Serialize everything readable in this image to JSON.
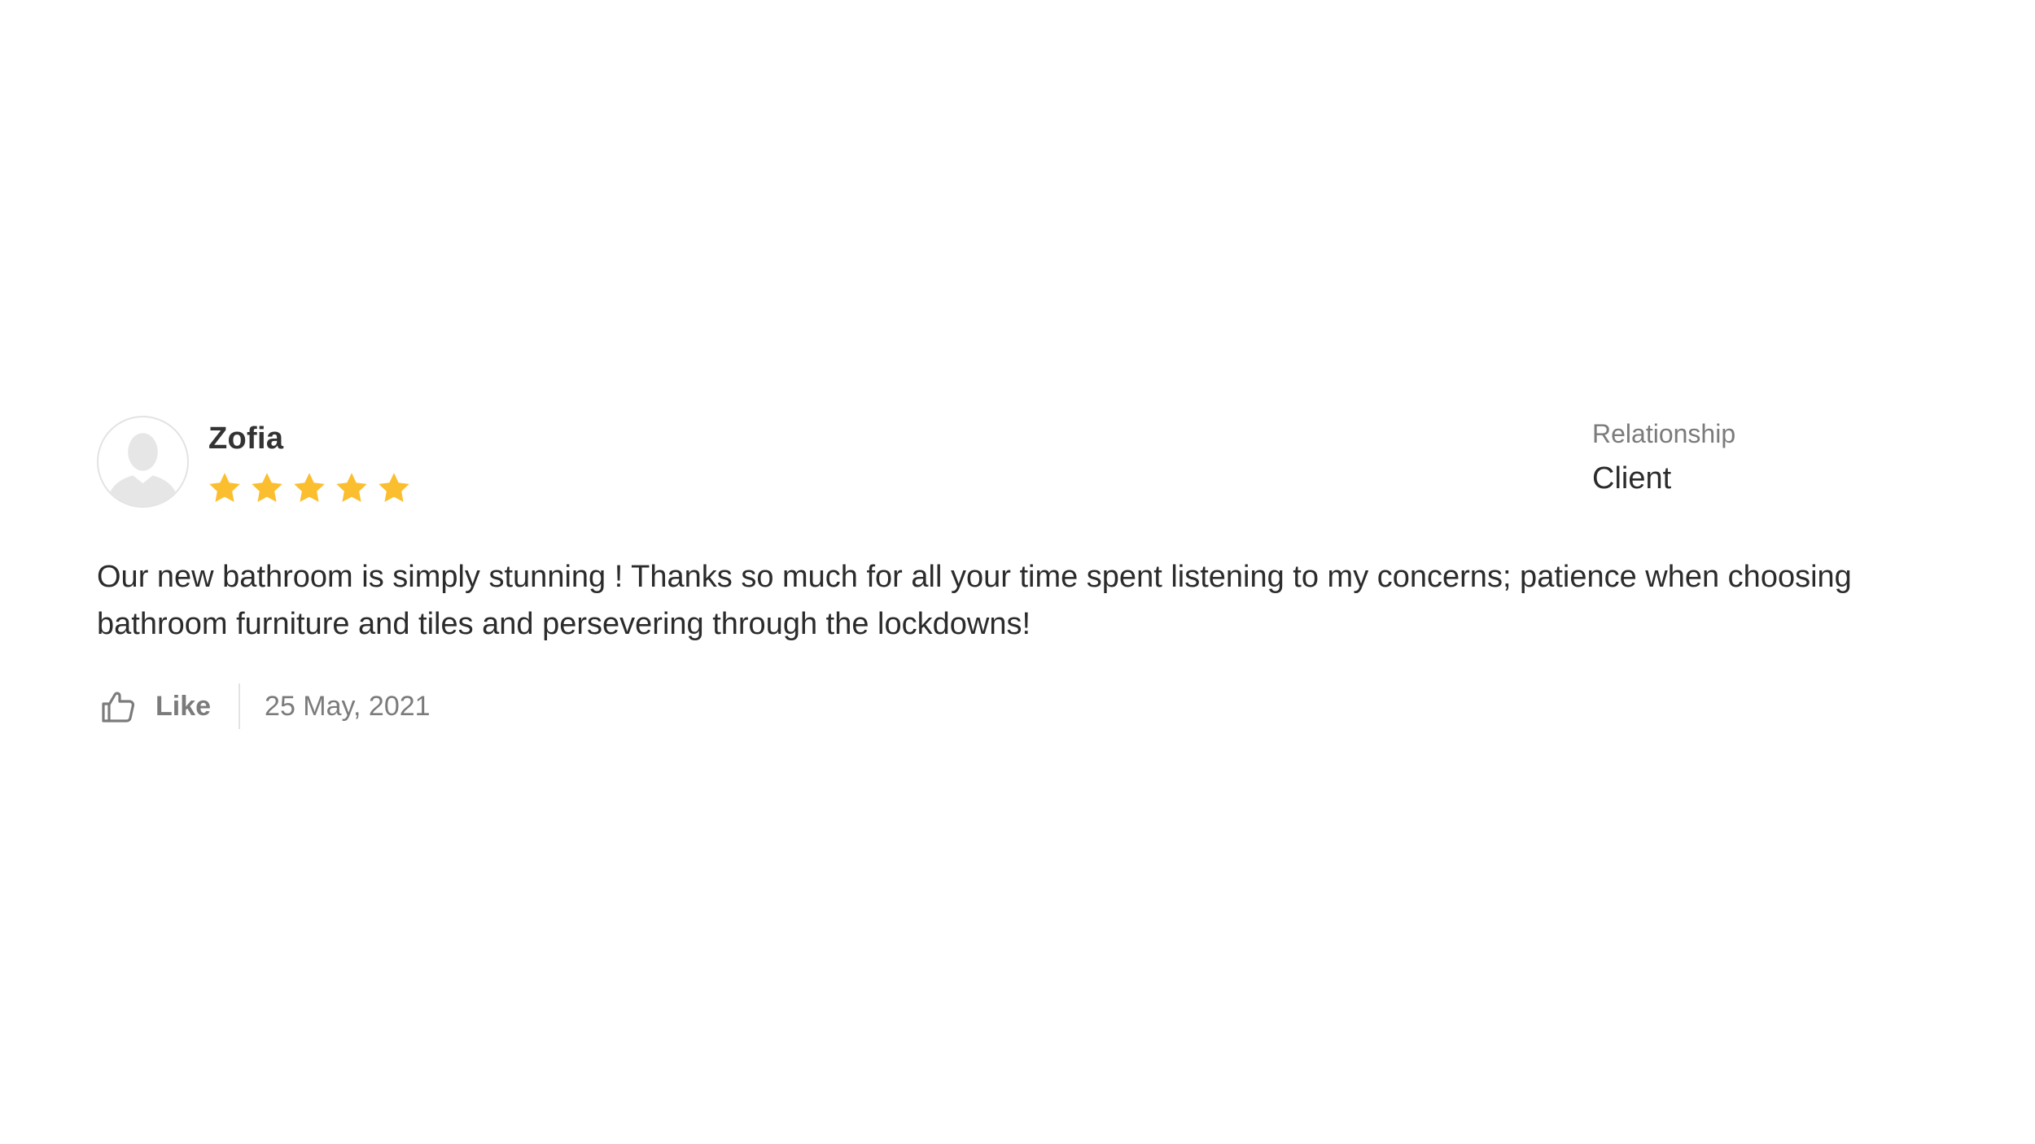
{
  "review": {
    "reviewer_name": "Zofia",
    "avatar_icon": "default-user-silhouette-icon",
    "rating": 5,
    "rating_max": 5,
    "star_color": "#FBBE2E",
    "relationship_label": "Relationship",
    "relationship_value": "Client",
    "text": "Our new bathroom is simply stunning !  Thanks so much for all your time spent listening to my concerns; patience when choosing bathroom furniture and tiles and persevering through the lockdowns!",
    "like_label": "Like",
    "like_icon": "thumbs-up-icon",
    "date": "25 May, 2021"
  }
}
